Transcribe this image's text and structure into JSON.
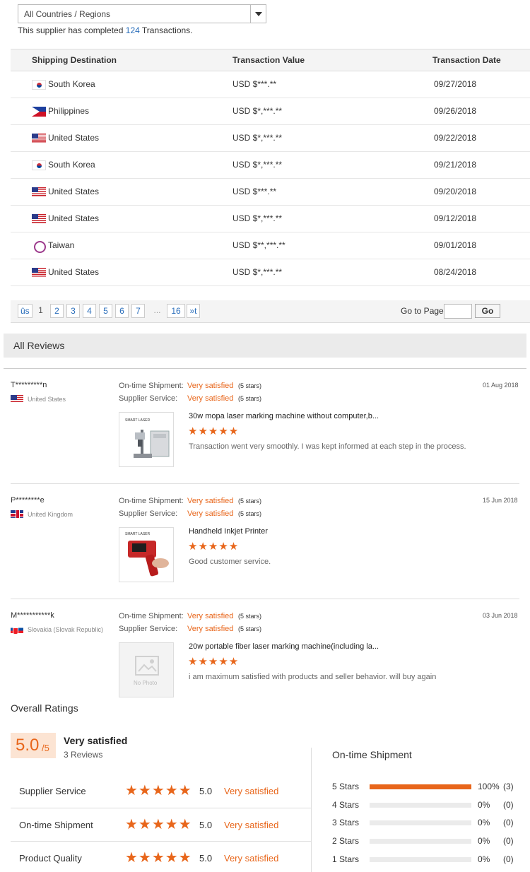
{
  "filter": {
    "country_select": "All Countries / Regions"
  },
  "summary": {
    "prefix": "This supplier has completed",
    "count": "124",
    "suffix": "Transactions."
  },
  "table": {
    "headers": [
      "Shipping Destination",
      "Transaction Value",
      "Transaction Date"
    ],
    "rows": [
      {
        "flag": "kr",
        "country": "South Korea",
        "value": "USD $***.**",
        "date": "09/27/2018"
      },
      {
        "flag": "ph",
        "country": "Philippines",
        "value": "USD $*,***.**",
        "date": "09/26/2018"
      },
      {
        "flag": "us",
        "country": "United States",
        "value": "USD $*,***.**",
        "date": "09/22/2018"
      },
      {
        "flag": "kr",
        "country": "South Korea",
        "value": "USD $*,***.**",
        "date": "09/21/2018"
      },
      {
        "flag": "us",
        "country": "United States",
        "value": "USD $***.**",
        "date": "09/20/2018"
      },
      {
        "flag": "us",
        "country": "United States",
        "value": "USD $*,***.**",
        "date": "09/12/2018"
      },
      {
        "flag": "tw",
        "country": "Taiwan",
        "value": "USD $**,***.**",
        "date": "09/01/2018"
      },
      {
        "flag": "us",
        "country": "United States",
        "value": "USD $*,***.**",
        "date": "08/24/2018"
      }
    ]
  },
  "pagination": {
    "prev": "ûs",
    "pages": [
      "1",
      "2",
      "3",
      "4",
      "5",
      "6",
      "7",
      "...",
      "16"
    ],
    "next": "»t",
    "current": "1",
    "goto_label": "Go to Page",
    "go_button": "Go"
  },
  "reviews_header": "All Reviews",
  "reviews": [
    {
      "name": "T*********n",
      "country": "United States",
      "flag": "us",
      "shipment_label": "On-time Shipment:",
      "shipment_value": "Very satisfied",
      "shipment_stars": "(5 stars)",
      "service_label": "Supplier Service:",
      "service_value": "Very satisfied",
      "service_stars": "(5 stars)",
      "date": "01 Aug 2018",
      "product": "30w mopa laser marking machine without computer,b...",
      "stars": "★★★★★",
      "text": "Transaction went very smoothly. I was kept informed at each step in the process.",
      "thumb": "laser-machine"
    },
    {
      "name": "P********e",
      "country": "United Kingdom",
      "flag": "gb",
      "shipment_label": "On-time Shipment:",
      "shipment_value": "Very satisfied",
      "shipment_stars": "(5 stars)",
      "service_label": "Supplier Service:",
      "service_value": "Very satisfied",
      "service_stars": "(5 stars)",
      "date": "15 Jun 2018",
      "product": "Handheld Inkjet Printer",
      "stars": "★★★★★",
      "text": "Good customer service.",
      "thumb": "inkjet-printer"
    },
    {
      "name": "M***********k",
      "country": "Slovakia (Slovak Republic)",
      "flag": "sk",
      "shipment_label": "On-time Shipment:",
      "shipment_value": "Very satisfied",
      "shipment_stars": "(5 stars)",
      "service_label": "Supplier Service:",
      "service_value": "Very satisfied",
      "service_stars": "(5 stars)",
      "date": "03 Jun 2018",
      "product": "20w portable fiber laser marking machine(including la...",
      "stars": "★★★★★",
      "text": "i am maximum satisfied with products and seller behavior. will buy again",
      "thumb": "no-photo",
      "no_photo_label": "No Photo"
    }
  ],
  "overall": {
    "title": "Overall Ratings",
    "score": "5.0",
    "score_max": "/5",
    "label": "Very satisfied",
    "count": "3 Reviews",
    "categories": [
      {
        "name": "Supplier Service",
        "stars": "★★★★★",
        "score": "5.0",
        "text": "Very satisfied"
      },
      {
        "name": "On-time Shipment",
        "stars": "★★★★★",
        "score": "5.0",
        "text": "Very satisfied"
      },
      {
        "name": "Product Quality",
        "stars": "★★★★★",
        "score": "5.0",
        "text": "Very satisfied"
      }
    ],
    "shipment": {
      "title": "On-time Shipment",
      "bars": [
        {
          "label": "5 Stars",
          "fraction": 1.0,
          "pct": "100%",
          "count": "(3)"
        },
        {
          "label": "4 Stars",
          "fraction": 0,
          "pct": "0%",
          "count": "(0)"
        },
        {
          "label": "3 Stars",
          "fraction": 0,
          "pct": "0%",
          "count": "(0)"
        },
        {
          "label": "2 Stars",
          "fraction": 0,
          "pct": "0%",
          "count": "(0)"
        },
        {
          "label": "1 Stars",
          "fraction": 0,
          "pct": "0%",
          "count": "(0)"
        }
      ]
    }
  },
  "colors": {
    "accent": "#e8661b",
    "link": "#2a6ebb"
  }
}
